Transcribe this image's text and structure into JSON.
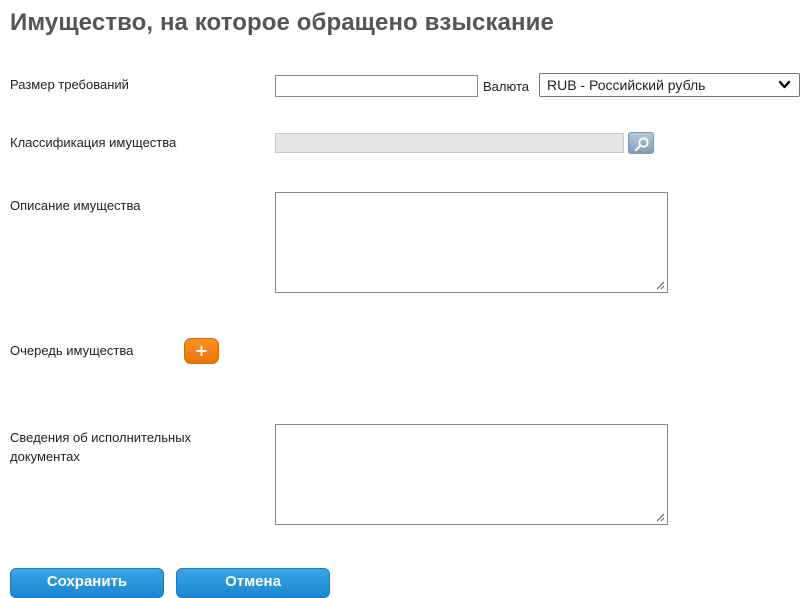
{
  "page": {
    "title": "Имущество, на которое обращено взыскание"
  },
  "form": {
    "claim_amount": {
      "label": "Размер требований",
      "value": ""
    },
    "currency": {
      "label": "Валюта",
      "selected": "RUB - Российский рубль"
    },
    "property_classification": {
      "label": "Классификация имущества",
      "value": ""
    },
    "property_description": {
      "label": "Описание имущества",
      "value": ""
    },
    "property_queue": {
      "label": "Очередь имущества",
      "add_button_label": "+"
    },
    "enforcement_documents": {
      "label": "Сведения об исполнительных документах",
      "value": ""
    }
  },
  "buttons": {
    "save_label": "Сохранить",
    "cancel_label": "Отмена"
  },
  "icons": {
    "search": "search-icon",
    "chevron": "chevron-down-icon",
    "resize": "resize-grip-icon",
    "add": "plus-icon"
  },
  "colors": {
    "title": "#555555",
    "add_button": "#f7941d",
    "action_button": "#2a96d9",
    "search_button": "#9bb4c8"
  }
}
